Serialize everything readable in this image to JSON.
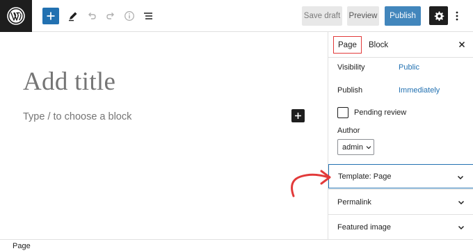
{
  "toolbar": {
    "save_draft_label": "Save draft",
    "preview_label": "Preview",
    "publish_label": "Publish"
  },
  "editor": {
    "title_placeholder": "Add title",
    "block_placeholder": "Type / to choose a block"
  },
  "sidebar": {
    "tabs": [
      {
        "label": "Page",
        "active": true
      },
      {
        "label": "Block",
        "active": false
      }
    ],
    "rows": [
      {
        "label": "Visibility",
        "value": "Public"
      },
      {
        "label": "Publish",
        "value": "Immediately"
      }
    ],
    "pending_review_label": "Pending review",
    "pending_review_checked": false,
    "author_label": "Author",
    "author_value": "admin",
    "panels": [
      {
        "label": "Template: Page",
        "highlighted": true
      },
      {
        "label": "Permalink",
        "highlighted": false
      },
      {
        "label": "Featured image",
        "highlighted": false
      }
    ]
  },
  "statusbar": {
    "text": "Page"
  },
  "colors": {
    "accent": "#2271b1",
    "annotation": "#e23a3a",
    "dark": "#1e1e1e"
  },
  "icons": [
    "wordpress-logo-icon",
    "plus-icon",
    "pencil-icon",
    "undo-icon",
    "redo-icon",
    "info-icon",
    "list-view-icon",
    "gear-icon",
    "more-vertical-icon",
    "close-icon",
    "chevron-down-icon",
    "curved-arrow-icon"
  ]
}
